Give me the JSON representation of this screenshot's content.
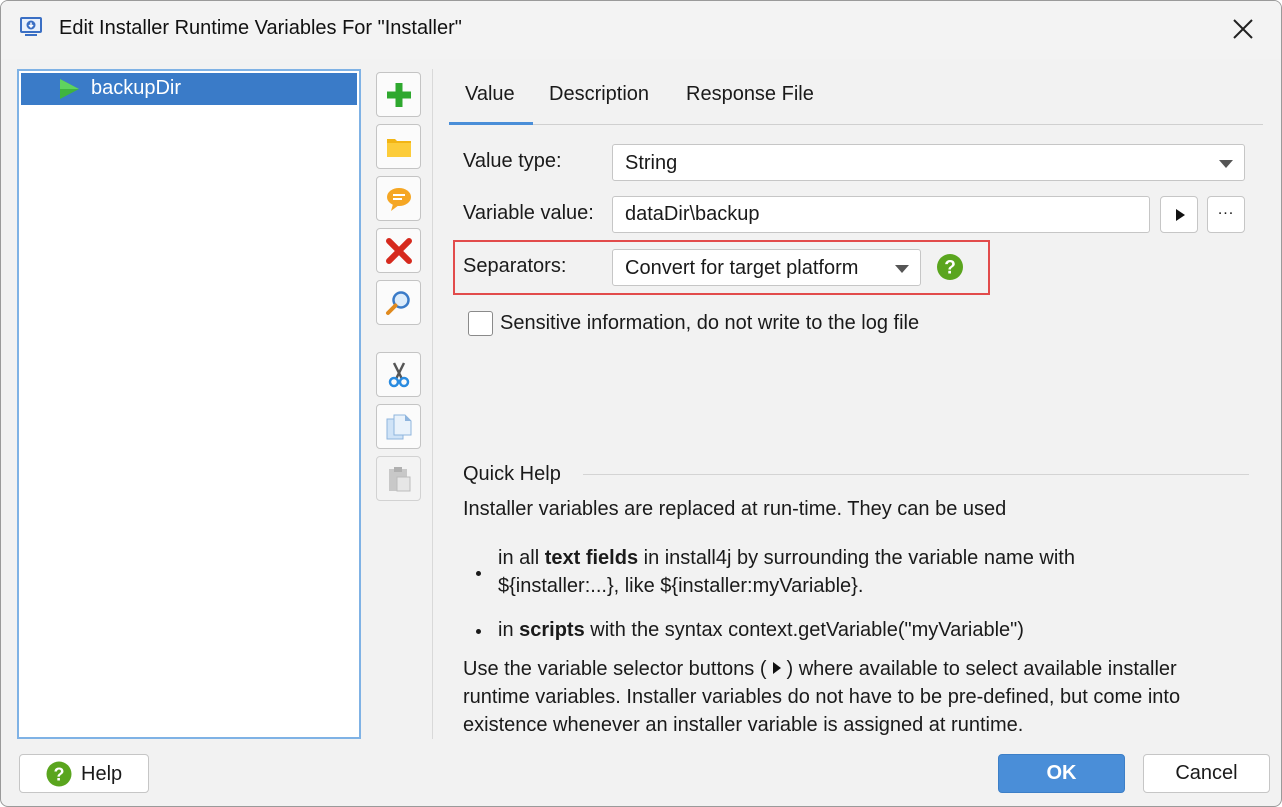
{
  "window": {
    "title": "Edit Installer Runtime Variables For \"Installer\"",
    "icon": "installer-app-icon"
  },
  "variables": [
    {
      "name": "backupDir",
      "icon": "play-triangle-icon",
      "selected": true
    }
  ],
  "toolbar": [
    {
      "name": "add",
      "icon": "plus-icon"
    },
    {
      "name": "folder",
      "icon": "folder-icon"
    },
    {
      "name": "comment",
      "icon": "speech-bubble-icon"
    },
    {
      "name": "delete",
      "icon": "red-x-icon"
    },
    {
      "name": "search",
      "icon": "magnifier-icon"
    },
    {
      "name": "cut",
      "icon": "scissors-icon"
    },
    {
      "name": "copy",
      "icon": "copy-icon"
    },
    {
      "name": "paste",
      "icon": "clipboard-icon",
      "disabled": true
    }
  ],
  "tabs": {
    "value": "Value",
    "description": "Description",
    "response_file": "Response File",
    "active": "Value"
  },
  "form": {
    "value_type_label": "Value type:",
    "value_type": "String",
    "variable_value_label": "Variable value:",
    "variable_value": "dataDir\\backup",
    "more_button": "...",
    "separators_label": "Separators:",
    "separators": "Convert for target platform",
    "sensitive_label": "Sensitive information, do not write to the log file",
    "sensitive_checked": false
  },
  "quick_help": {
    "heading": "Quick Help",
    "intro": "Installer variables are replaced at run-time. They can be used",
    "bullet1_pre": "in all ",
    "bullet1_bold": "text fields",
    "bullet1_post": " in install4j by surrounding the variable name with",
    "bullet1_line2": "${installer:...}, like ${installer:myVariable}.",
    "bullet2_pre": "in ",
    "bullet2_bold": "scripts",
    "bullet2_post": " with the syntax context.getVariable(\"myVariable\")",
    "para_line1_pre": "Use the variable selector buttons (",
    "para_line1_post": ") where available to select available installer",
    "para_line2": "runtime variables. Installer variables do not have to be pre-defined, but come into",
    "para_line3": "existence whenever an installer variable is assigned at runtime."
  },
  "buttons": {
    "help": "Help",
    "ok": "OK",
    "cancel": "Cancel"
  },
  "colors": {
    "selection": "#3a7bc8",
    "accent": "#4a8ed8",
    "highlight_border": "#e24b4b",
    "help_green": "#5aa51e"
  }
}
